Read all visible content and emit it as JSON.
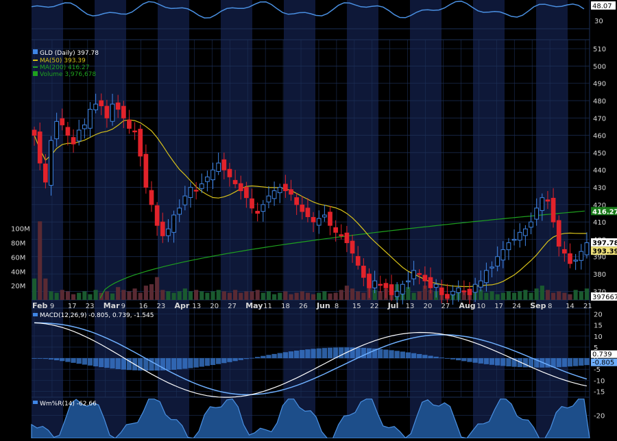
{
  "colors": {
    "background": "#000000",
    "band": "#0e1838",
    "grid": "#1d3058",
    "axis_text": "#d8d8d8",
    "up": "#3f86e6",
    "down": "#e2232b",
    "ma50": "#d8c21a",
    "ma200": "#1fa11f",
    "volume": "#1a5a2f",
    "volume_down": "#5a2a33",
    "macd_fast": "#ffffff",
    "macd_slow": "#6fb0ff",
    "macd_hist": "#3f86e6",
    "willr": "#4a90e2"
  },
  "chart_data": [
    {
      "name": "top-oscillator",
      "type": "line",
      "y_tick_labels": [
        "30"
      ],
      "last_value_label": "48.07",
      "ylim": [
        20,
        50
      ]
    },
    {
      "name": "price",
      "type": "candlestick",
      "ylim": [
        365,
        512
      ],
      "y_ticks": [
        370,
        380,
        390,
        400,
        410,
        420,
        430,
        440,
        450,
        460,
        470,
        480,
        490,
        500,
        510
      ],
      "x_tick_labels": [
        "Feb",
        "9",
        "17",
        "23",
        "Mar",
        "9",
        "16",
        "23",
        "Apr",
        "13",
        "20",
        "27",
        "May",
        "11",
        "18",
        "26",
        "Jun",
        "8",
        "15",
        "22",
        "Jul",
        "13",
        "20",
        "27",
        "Aug",
        "10",
        "17",
        "24",
        "Sep",
        "8",
        "14",
        "21"
      ],
      "bold_x_tick_labels": [
        "Feb",
        "Mar",
        "Apr",
        "May",
        "Jun",
        "Jul",
        "Aug",
        "Sep"
      ],
      "legend": [
        {
          "label": "GLD (Daily) 397.78",
          "color": "#3f86e6",
          "icon": "candle-icon"
        },
        {
          "label": "MA(50) 393.39",
          "color": "#d8c21a",
          "icon": "line-icon"
        },
        {
          "label": "MA(200) 416.27",
          "color": "#1fa11f",
          "icon": "line-icon"
        },
        {
          "label": "Volume 3,976,678",
          "color": "#1fa11f",
          "icon": "bar-icon"
        }
      ],
      "right_tags": [
        {
          "label": "416.27",
          "value": 416.27,
          "bg": "#1a7a1a",
          "fg": "#ffffff"
        },
        {
          "label": "397.78",
          "value": 398.2,
          "bg": "#ffffff",
          "fg": "#000000"
        },
        {
          "label": "393.39",
          "value": 393.39,
          "bg": "#f0e27a",
          "fg": "#000000"
        }
      ],
      "close": [
        460,
        444,
        433,
        457,
        468,
        466,
        460,
        455,
        463,
        466,
        475,
        478,
        477,
        470,
        478,
        475,
        470,
        464,
        462,
        448,
        430,
        420,
        408,
        402,
        406,
        414,
        418,
        425,
        430,
        428,
        432,
        436,
        440,
        444,
        440,
        436,
        432,
        428,
        424,
        418,
        415,
        420,
        425,
        428,
        430,
        428,
        426,
        420,
        416,
        413,
        410,
        412,
        414,
        408,
        404,
        402,
        398,
        392,
        385,
        378,
        372,
        376,
        374,
        372,
        368,
        370,
        374,
        376,
        382,
        380,
        376,
        372,
        374,
        368,
        366,
        370,
        372,
        370,
        368,
        374,
        376,
        382,
        384,
        390,
        394,
        398,
        400,
        404,
        406,
        410,
        418,
        424,
        422,
        410,
        396,
        392,
        386,
        388,
        393,
        398
      ]
    },
    {
      "name": "volume",
      "type": "bar",
      "y_tick_labels": [
        "100M",
        "80M",
        "60M",
        "40M",
        "20M"
      ],
      "ylim": [
        0,
        115
      ],
      "last_value_label": "397667",
      "values": [
        30,
        110,
        30,
        12,
        10,
        14,
        12,
        8,
        10,
        12,
        8,
        14,
        10,
        12,
        9,
        18,
        14,
        12,
        16,
        10,
        20,
        22,
        32,
        14,
        12,
        10,
        12,
        16,
        12,
        14,
        12,
        10,
        12,
        14,
        12,
        10,
        14,
        10,
        12,
        12,
        14,
        10,
        12,
        8,
        10,
        12,
        8,
        10,
        12,
        10,
        8,
        10,
        12,
        9,
        10,
        14,
        20,
        16,
        12,
        10,
        18,
        14,
        12,
        16,
        12,
        22,
        14,
        18,
        10,
        12,
        20,
        14,
        12,
        10,
        8,
        12,
        10,
        12,
        8,
        10,
        14,
        10,
        12,
        8,
        10,
        12,
        10,
        12,
        14,
        10,
        16,
        20,
        14,
        10,
        12,
        10,
        8,
        14,
        12,
        16
      ]
    },
    {
      "name": "macd",
      "type": "line",
      "legend_label": "MACD(12,26,9) -0.805, 0.739, -1.545",
      "y_ticks": [
        20,
        15,
        10,
        5,
        0,
        -5,
        -10,
        -15
      ],
      "ylim": [
        -17,
        22
      ],
      "tags": [
        {
          "label": "0.739",
          "value": 0.739
        },
        {
          "label": "-0.805",
          "value": -0.805
        }
      ]
    },
    {
      "name": "williams-r",
      "type": "area",
      "legend_label": "Wm%R(14) -62.66",
      "y_ticks": [
        -20
      ],
      "ylim": [
        -45,
        0
      ]
    }
  ]
}
